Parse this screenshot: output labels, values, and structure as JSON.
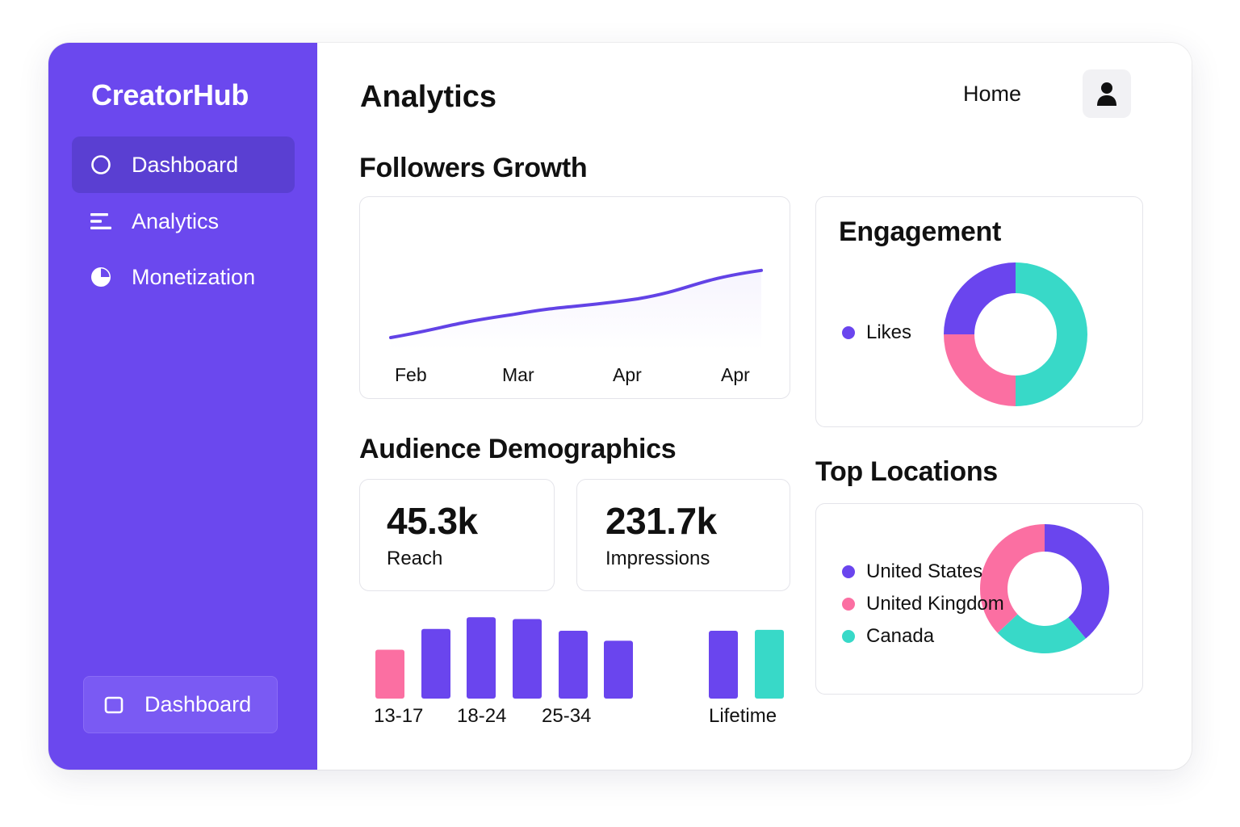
{
  "app": {
    "brand": "CreatorHub"
  },
  "sidebar": {
    "items": [
      {
        "label": "Dashboard",
        "icon": "circle-icon",
        "active": true
      },
      {
        "label": "Analytics",
        "icon": "bars-icon",
        "active": false
      },
      {
        "label": "Monetization",
        "icon": "pie-icon",
        "active": false
      }
    ],
    "footer_button": {
      "label": "Dashboard",
      "icon": "square-icon"
    }
  },
  "header": {
    "title": "Analytics",
    "home_label": "Home",
    "avatar_icon": "user-icon"
  },
  "followers": {
    "title": "Followers Growth",
    "months": [
      "Feb",
      "Mar",
      "Apr",
      "Apr"
    ]
  },
  "engagement": {
    "title": "Engagement",
    "legend": [
      {
        "label": "Likes",
        "color": "#6a45ee"
      }
    ]
  },
  "demographics": {
    "title": "Audience Demographics",
    "stats": [
      {
        "value": "45.3k",
        "label": "Reach"
      },
      {
        "value": "231.7k",
        "label": "Impressions"
      }
    ],
    "age_labels": [
      "13-17",
      "18-24",
      "25-34"
    ],
    "lifetime_label": "Lifetime"
  },
  "locations": {
    "title": "Top Locations",
    "legend": [
      {
        "label": "United States",
        "color": "#6a45ee"
      },
      {
        "label": "United Kingdom",
        "color": "#fb6fa2"
      },
      {
        "label": "Canada",
        "color": "#38d9c8"
      }
    ]
  },
  "colors": {
    "purple": "#6b48ee",
    "pink": "#fb6fa2",
    "teal": "#38d9c8"
  },
  "chart_data": [
    {
      "type": "line",
      "x": [
        "Feb",
        "Mar",
        "Apr",
        "Apr"
      ],
      "series": [
        {
          "values": [
            10,
            28,
            40,
            62
          ]
        }
      ],
      "ylim": [
        0,
        100
      ]
    },
    {
      "type": "pie",
      "slices": [
        {
          "value": 50,
          "color": "#38d9c8"
        },
        {
          "value": 25,
          "color": "#fb6fa2"
        },
        {
          "value": 25,
          "color": "#6a45ee"
        }
      ]
    },
    {
      "type": "bar",
      "values": [
        54,
        77,
        90,
        88,
        75,
        64,
        75,
        76
      ],
      "colors": [
        "#fb6fa2",
        "#6a45ee",
        "#6a45ee",
        "#6a45ee",
        "#6a45ee",
        "#6a45ee",
        "#6a45ee",
        "#38d9c8"
      ],
      "ylim": [
        0,
        100
      ]
    },
    {
      "type": "pie",
      "slices": [
        {
          "value": 39,
          "color": "#6a45ee"
        },
        {
          "value": 24,
          "color": "#38d9c8"
        },
        {
          "value": 37,
          "color": "#fb6fa2"
        }
      ]
    }
  ]
}
